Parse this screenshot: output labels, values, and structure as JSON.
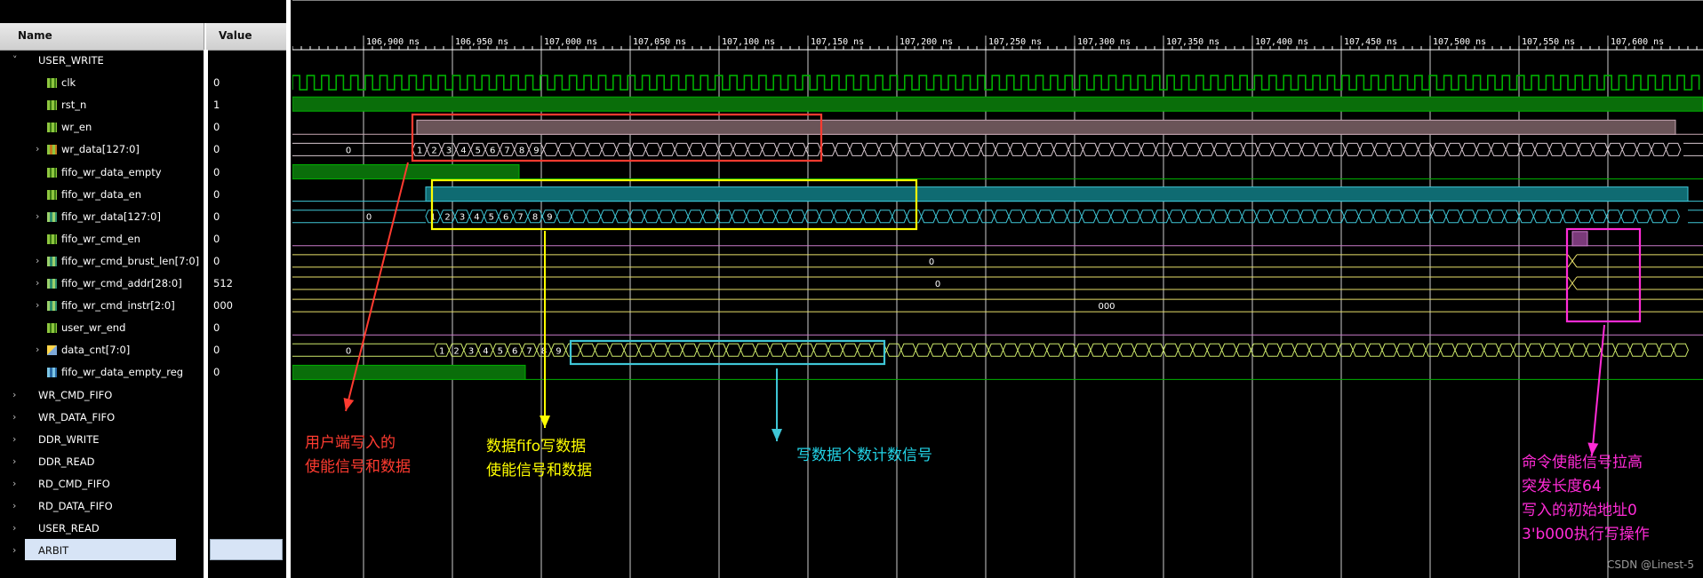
{
  "header": {
    "name_col": "Name",
    "value_col": "Value"
  },
  "signals": [
    {
      "name": "USER_WRITE",
      "value": "",
      "kind": "group",
      "expander": "v",
      "indent": 0
    },
    {
      "name": "clk",
      "value": "0",
      "kind": "bit",
      "indent": 2
    },
    {
      "name": "rst_n",
      "value": "1",
      "kind": "bit",
      "indent": 2
    },
    {
      "name": "wr_en",
      "value": "0",
      "kind": "bit",
      "indent": 2
    },
    {
      "name": "wr_data[127:0]",
      "value": "0",
      "kind": "bus",
      "expander": ">",
      "indent": 2
    },
    {
      "name": "fifo_wr_data_empty",
      "value": "0",
      "kind": "bit",
      "indent": 2
    },
    {
      "name": "fifo_wr_data_en",
      "value": "0",
      "kind": "bit",
      "indent": 2
    },
    {
      "name": "fifo_wr_data[127:0]",
      "value": "0",
      "kind": "bus2",
      "expander": ">",
      "indent": 2
    },
    {
      "name": "fifo_wr_cmd_en",
      "value": "0",
      "kind": "bit",
      "indent": 2
    },
    {
      "name": "fifo_wr_cmd_brust_len[7:0]",
      "value": "0",
      "kind": "bus2",
      "expander": ">",
      "indent": 2
    },
    {
      "name": "fifo_wr_cmd_addr[28:0]",
      "value": "512",
      "kind": "bus2",
      "expander": ">",
      "indent": 2
    },
    {
      "name": "fifo_wr_cmd_instr[2:0]",
      "value": "000",
      "kind": "bus2",
      "expander": ">",
      "indent": 2
    },
    {
      "name": "user_wr_end",
      "value": "0",
      "kind": "bit",
      "indent": 2
    },
    {
      "name": "data_cnt[7:0]",
      "value": "0",
      "kind": "cnt",
      "expander": ">",
      "indent": 2
    },
    {
      "name": "fifo_wr_data_empty_reg",
      "value": "0",
      "kind": "reg",
      "indent": 2
    },
    {
      "name": "WR_CMD_FIFO",
      "value": "",
      "kind": "group",
      "expander": ">",
      "indent": 0
    },
    {
      "name": "WR_DATA_FIFO",
      "value": "",
      "kind": "group",
      "expander": ">",
      "indent": 0
    },
    {
      "name": "DDR_WRITE",
      "value": "",
      "kind": "group",
      "expander": ">",
      "indent": 0
    },
    {
      "name": "DDR_READ",
      "value": "",
      "kind": "group",
      "expander": ">",
      "indent": 0
    },
    {
      "name": "RD_CMD_FIFO",
      "value": "",
      "kind": "group",
      "expander": ">",
      "indent": 0
    },
    {
      "name": "RD_DATA_FIFO",
      "value": "",
      "kind": "group",
      "expander": ">",
      "indent": 0
    },
    {
      "name": "USER_READ",
      "value": "",
      "kind": "group",
      "expander": ">",
      "indent": 0
    },
    {
      "name": "ARBIT",
      "value": "",
      "kind": "group",
      "expander": ">",
      "indent": 0,
      "selected": true
    }
  ],
  "timeline": {
    "ticks": [
      "106,900 ns",
      "106,950 ns",
      "107,000 ns",
      "107,050 ns",
      "107,100 ns",
      "107,150 ns",
      "107,200 ns",
      "107,250 ns",
      "107,300 ns",
      "107,350 ns",
      "107,400 ns",
      "107,450 ns",
      "107,500 ns",
      "107,550 ns",
      "107,600 ns"
    ]
  },
  "bus_labels": {
    "wr_data_initial": "0",
    "fifo_wr_data_initial": "0",
    "brust_len": "0",
    "cmd_addr": "0",
    "cmd_instr": "000",
    "data_cnt_initial": "0",
    "seq": [
      "1",
      "2",
      "3",
      "4",
      "5",
      "6",
      "7",
      "8",
      "9"
    ]
  },
  "annotations": {
    "red": {
      "text": "用户端写入的\n使能信号和数据",
      "color": "#ff3b30"
    },
    "yellow": {
      "text": "数据fifo写数据\n使能信号和数据",
      "color": "#ffff00"
    },
    "cyan": {
      "text": "写数据个数计数信号",
      "color": "#22d3e6"
    },
    "magenta": {
      "text": "命令使能信号拉高\n突发长度64\n写入的初始地址0\n3'b000执行写操作",
      "color": "#ff2bd6"
    }
  },
  "watermark": "CSDN @Linest-5",
  "colors": {
    "green": "#00b000",
    "bar_green": "#0a6e0a",
    "cyan": "#3fc6d6",
    "wr_en": "#c8a8b4",
    "grey_brown": "#6a5458"
  }
}
